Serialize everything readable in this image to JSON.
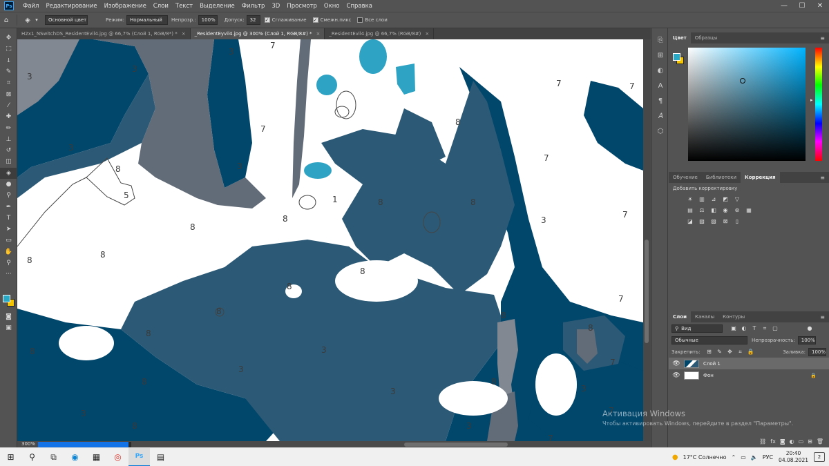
{
  "app": {
    "logo": "Ps"
  },
  "menubar": {
    "items": [
      "Файл",
      "Редактирование",
      "Изображение",
      "Слои",
      "Текст",
      "Выделение",
      "Фильтр",
      "3D",
      "Просмотр",
      "Окно",
      "Справка"
    ]
  },
  "window_controls": {
    "minimize": "—",
    "maximize": "☐",
    "close": "✕"
  },
  "options_bar": {
    "home_icon": "home-icon",
    "tool_icon": "paint-bucket-icon",
    "source": "Основной цвет",
    "mode_label": "Режим:",
    "mode_value": "Нормальный",
    "opacity_label": "Непрозр.:",
    "opacity_value": "100%",
    "tolerance_label": "Допуск:",
    "tolerance_value": "32",
    "antialias_label": "Сглаживание",
    "antialias_checked": true,
    "contiguous_label": "Смежн.пикс",
    "contiguous_checked": true,
    "all_layers_label": "Все слои",
    "all_layers_checked": false
  },
  "tabs": [
    {
      "label": "H2x1_NSwitchDS_ResidentEvil4.jpg @ 66,7% (Слой 1, RGB/8*) *",
      "active": false
    },
    {
      "label": "_ResidentEyvil4.jpg @ 300% (Слой 1, RGB/8#) *",
      "active": true
    },
    {
      "label": "_ResidentEvil4.jpg @ 66,7% (RGB/8#)",
      "active": false
    }
  ],
  "tab_close": "×",
  "canvas": {
    "colors": {
      "dark_blue": "#01466b",
      "mid_blue": "#2c5a76",
      "gray": "#626b78",
      "light_gray": "#818892",
      "cyan": "#2ea3c4",
      "white": "#ffffff"
    },
    "numbers": [
      "7",
      "3",
      "3",
      "3",
      "3",
      "3",
      "7",
      "8",
      "8",
      "8",
      "5",
      "1",
      "8",
      "8",
      "8",
      "7",
      "7",
      "7",
      "7",
      "7",
      "3",
      "8",
      "8",
      "8",
      "8",
      "8",
      "8",
      "8",
      "8",
      "8",
      "3",
      "3",
      "3",
      "3",
      "7",
      "7",
      "7",
      "8",
      "8",
      "3",
      "3",
      "8"
    ]
  },
  "statusbar": {
    "zoom": "300%",
    "progress_percent": 97
  },
  "right_panel": {
    "color_tabs": [
      "Цвет",
      "Образцы"
    ],
    "adjust_tabs": [
      "Обучение",
      "Библиотеки",
      "Коррекция"
    ],
    "adjust_title": "Добавить корректировку",
    "layers_tabs": [
      "Слои",
      "Каналы",
      "Контуры"
    ],
    "kind_filter": "Вид",
    "blend_mode": "Обычные",
    "opacity_label": "Непрозрачность:",
    "opacity_value": "100%",
    "lock_label": "Закрепить:",
    "fill_label": "Заливка:",
    "fill_value": "100%",
    "layers": [
      {
        "name": "Слой 1",
        "selected": true,
        "locked": false
      },
      {
        "name": "Фон",
        "selected": false,
        "locked": true
      }
    ]
  },
  "activation": {
    "title": "Активация Windows",
    "subtitle": "Чтобы активировать Windows, перейдите в раздел \"Параметры\"."
  },
  "taskbar": {
    "weather": "17°C  Солнечно",
    "lang": "РУС",
    "time": "20:40",
    "date": "04.08.2021",
    "notifications": "2"
  }
}
